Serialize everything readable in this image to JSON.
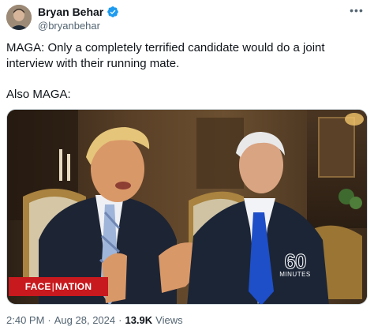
{
  "author": {
    "display_name": "Bryan Behar",
    "handle": "@bryanbehar",
    "verified": true
  },
  "tweet": {
    "paragraphs": [
      "MAGA: Only a completely terrified candidate would do a joint interview with their running mate.",
      "Also MAGA:"
    ]
  },
  "media": {
    "logo_face": "FACE",
    "logo_nation": "NATION",
    "program_badge_number": "60",
    "program_badge_word": "MINUTES"
  },
  "footer": {
    "time": "2:40 PM",
    "separator": "·",
    "date": "Aug 28, 2024",
    "views_count": "13.9K",
    "views_label": "Views"
  },
  "icons": {
    "more": "more-horizontal-icon",
    "verified": "verified-badge-icon"
  },
  "colors": {
    "accent": "#1d9bf0",
    "text": "#0f1419",
    "muted": "#536471",
    "ftn_red": "#c8191e"
  }
}
